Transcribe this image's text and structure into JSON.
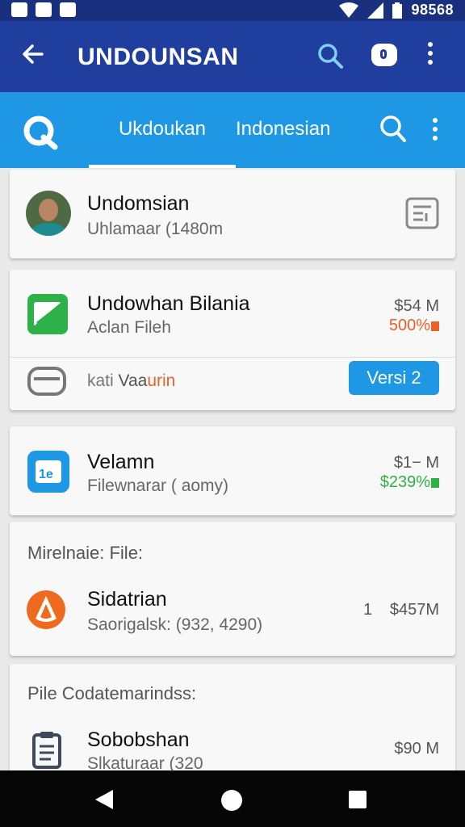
{
  "status_bar": {
    "time": "98568"
  },
  "app_bar": {
    "title": "UNDOUNSAN"
  },
  "tabs": [
    {
      "label": "Ukdoukan"
    },
    {
      "label": "Indonesian"
    }
  ],
  "items": [
    {
      "title": "Undomsian",
      "subtitle": "Uhlamaar (1480m"
    },
    {
      "title": "Undowhan Bilania",
      "subtitle": "Aclan Fileh",
      "price": "$54 M",
      "change": "500%",
      "footer_label": "kati",
      "footer_tag_a": "Vaa",
      "footer_tag_b": "urin",
      "action": "Versi 2"
    },
    {
      "title": "Velamn",
      "subtitle": "Filewnarar ( aomy)",
      "price": "$1− M",
      "change": "$239%"
    },
    {
      "section": "Mirelnaie: File:",
      "title": "Sidatrian",
      "subtitle": "Saorigalsk: (932, 4290)",
      "count": "1",
      "price": "$457M"
    },
    {
      "section": "Pile Codatemarindss:",
      "title": "Sobobshan",
      "subtitle": "Slkaturaar (320",
      "price": "$90 M"
    }
  ],
  "colors": {
    "status_bar": "#18307e",
    "app_bar": "#1f3e9e",
    "tab_bar": "#1e97e4",
    "change_orange": "#e8622b",
    "change_green": "#2fb146",
    "action_button": "#1e97e4"
  },
  "icons": {
    "back": "arrow-left-icon",
    "search": "search-icon",
    "account": "account-badge-icon",
    "more": "more-vert-icon",
    "brand": "brand-logo-icon",
    "doc": "document-icon",
    "app1": "green-app-icon",
    "toggle": "toggle-icon",
    "app2": "blue-app-icon",
    "app3": "orange-flame-icon",
    "clipboard": "clipboard-icon"
  }
}
